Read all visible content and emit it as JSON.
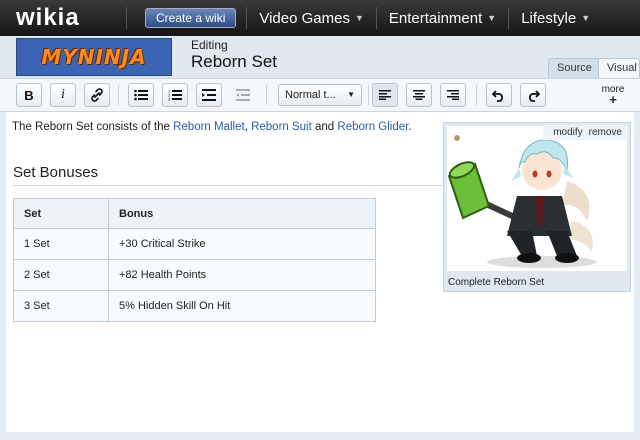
{
  "nav": {
    "logo": "wikia",
    "create_wiki": "Create a wiki",
    "items": [
      {
        "label": "Video Games"
      },
      {
        "label": "Entertainment"
      },
      {
        "label": "Lifestyle"
      }
    ]
  },
  "header": {
    "wiki_logo": "MYNINJA",
    "editing_label": "Editing",
    "page_title": "Reborn Set",
    "tabs": {
      "source": "Source",
      "visual": "Visual"
    }
  },
  "toolbar": {
    "bold": "B",
    "italic": "i",
    "format_select": "Normal t...",
    "more_label": "more",
    "more_plus": "+"
  },
  "content": {
    "intro_prefix": "The Reborn Set consists of the ",
    "link_mallet": "Reborn Mallet",
    "sep1": ", ",
    "link_suit": "Reborn Suit",
    "sep2": " and ",
    "link_glider": "Reborn Glider",
    "intro_suffix": ".",
    "section_heading": "Set Bonuses",
    "table": {
      "headers": [
        "Set",
        "Bonus"
      ],
      "rows": [
        [
          "1 Set",
          "+30 Critical Strike"
        ],
        [
          "2 Set",
          "+82 Health Points"
        ],
        [
          "3 Set",
          "5% Hidden Skill On Hit"
        ]
      ]
    },
    "image": {
      "modify": "modify",
      "remove": "remove",
      "caption": "Complete Reborn Set"
    }
  },
  "colors": {
    "link": "#2b5ea6",
    "nav_bg": "#151515",
    "hammer_green": "#6cbf3a",
    "hair": "#bfe6ee"
  }
}
